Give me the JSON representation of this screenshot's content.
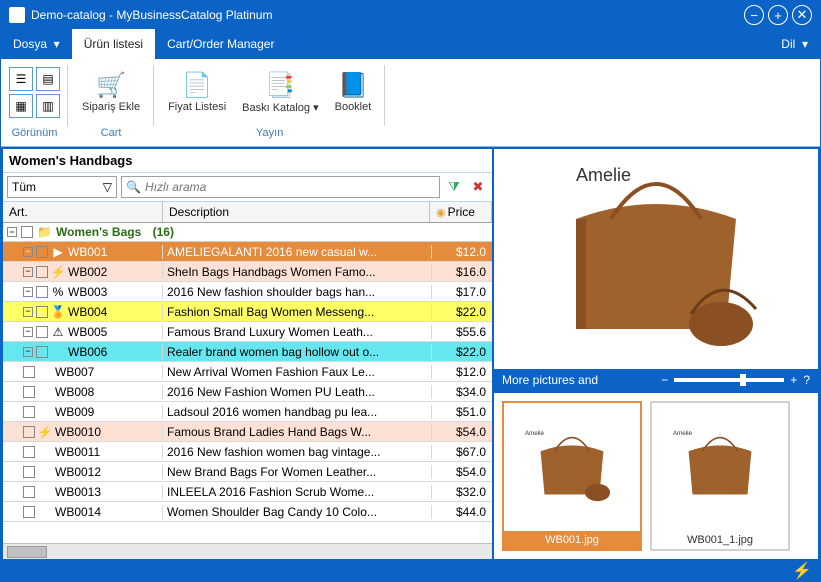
{
  "title": "Demo-catalog - MyBusinessCatalog Platinum",
  "menu": {
    "dosya": "Dosya",
    "urun": "Ürün listesi",
    "cart": "Cart/Order Manager",
    "dil": "Dil"
  },
  "ribbon": {
    "gorunum": "Görünüm",
    "cart": "Cart",
    "yayin": "Yayın",
    "siparis": "Sipariş Ekle",
    "fiyat": "Fiyat Listesi",
    "baski": "Baskı Katalog",
    "booklet": "Booklet"
  },
  "category": "Women's Handbags",
  "filter": {
    "tum": "Tüm",
    "search_placeholder": "Hızlı arama"
  },
  "headers": {
    "art": "Art.",
    "desc": "Description",
    "price": "Price"
  },
  "group": {
    "name": "Women's Bags",
    "count": "(16)"
  },
  "chart_data": {
    "type": "table",
    "columns": [
      "Art.",
      "Description",
      "Price"
    ],
    "rows": [
      {
        "art": "WB001",
        "desc": "AMELIEGALANTI 2016 new casual w...",
        "price": "$12.0",
        "bg": "#e68a3c",
        "fg": "#fff",
        "icon": "▶",
        "toggle": true
      },
      {
        "art": "WB002",
        "desc": "SheIn Bags Handbags Women Famo...",
        "price": "$16.0",
        "bg": "#fce1d4",
        "icon": "⚡",
        "toggle": true
      },
      {
        "art": "WB003",
        "desc": "2016 New fashion shoulder bags han...",
        "price": "$17.0",
        "bg": "#ffffff",
        "icon": "%",
        "toggle": true
      },
      {
        "art": "WB004",
        "desc": "Fashion Small Bag Women Messeng...",
        "price": "$22.0",
        "bg": "#ffff66",
        "icon": "🏅",
        "toggle": true
      },
      {
        "art": "WB005",
        "desc": "Famous Brand Luxury Women Leath...",
        "price": "$55.6",
        "bg": "#ffffff",
        "icon": "⚠",
        "toggle": true
      },
      {
        "art": "WB006",
        "desc": "Realer brand women bag hollow out o...",
        "price": "$22.0",
        "bg": "#66e6ee",
        "toggle": true
      },
      {
        "art": "WB007",
        "desc": "New Arrival Women Fashion Faux Le...",
        "price": "$12.0",
        "bg": "#ffffff"
      },
      {
        "art": "WB008",
        "desc": "2016 New Fashion Women PU Leath...",
        "price": "$34.0",
        "bg": "#ffffff"
      },
      {
        "art": "WB009",
        "desc": "Ladsoul 2016 women handbag pu lea...",
        "price": "$51.0",
        "bg": "#ffffff"
      },
      {
        "art": "WB0010",
        "desc": "Famous Brand Ladies Hand Bags W...",
        "price": "$54.0",
        "bg": "#fce1d4",
        "icon": "⚡"
      },
      {
        "art": "WB0011",
        "desc": "2016 New fashion women bag vintage...",
        "price": "$67.0",
        "bg": "#ffffff"
      },
      {
        "art": "WB0012",
        "desc": "New Brand Bags For Women Leather...",
        "price": "$54.0",
        "bg": "#ffffff"
      },
      {
        "art": "WB0013",
        "desc": "INLEELA 2016 Fashion Scrub Wome...",
        "price": "$32.0",
        "bg": "#ffffff"
      },
      {
        "art": "WB0014",
        "desc": "Women Shoulder Bag Candy 10 Colo...",
        "price": "$44.0",
        "bg": "#ffffff"
      }
    ]
  },
  "gallery": {
    "title": "More pictures and",
    "help": "?",
    "thumbs": [
      {
        "label": "WB001.jpg",
        "active": true
      },
      {
        "label": "WB001_1.jpg",
        "active": false
      }
    ]
  },
  "brand": "Amelie"
}
